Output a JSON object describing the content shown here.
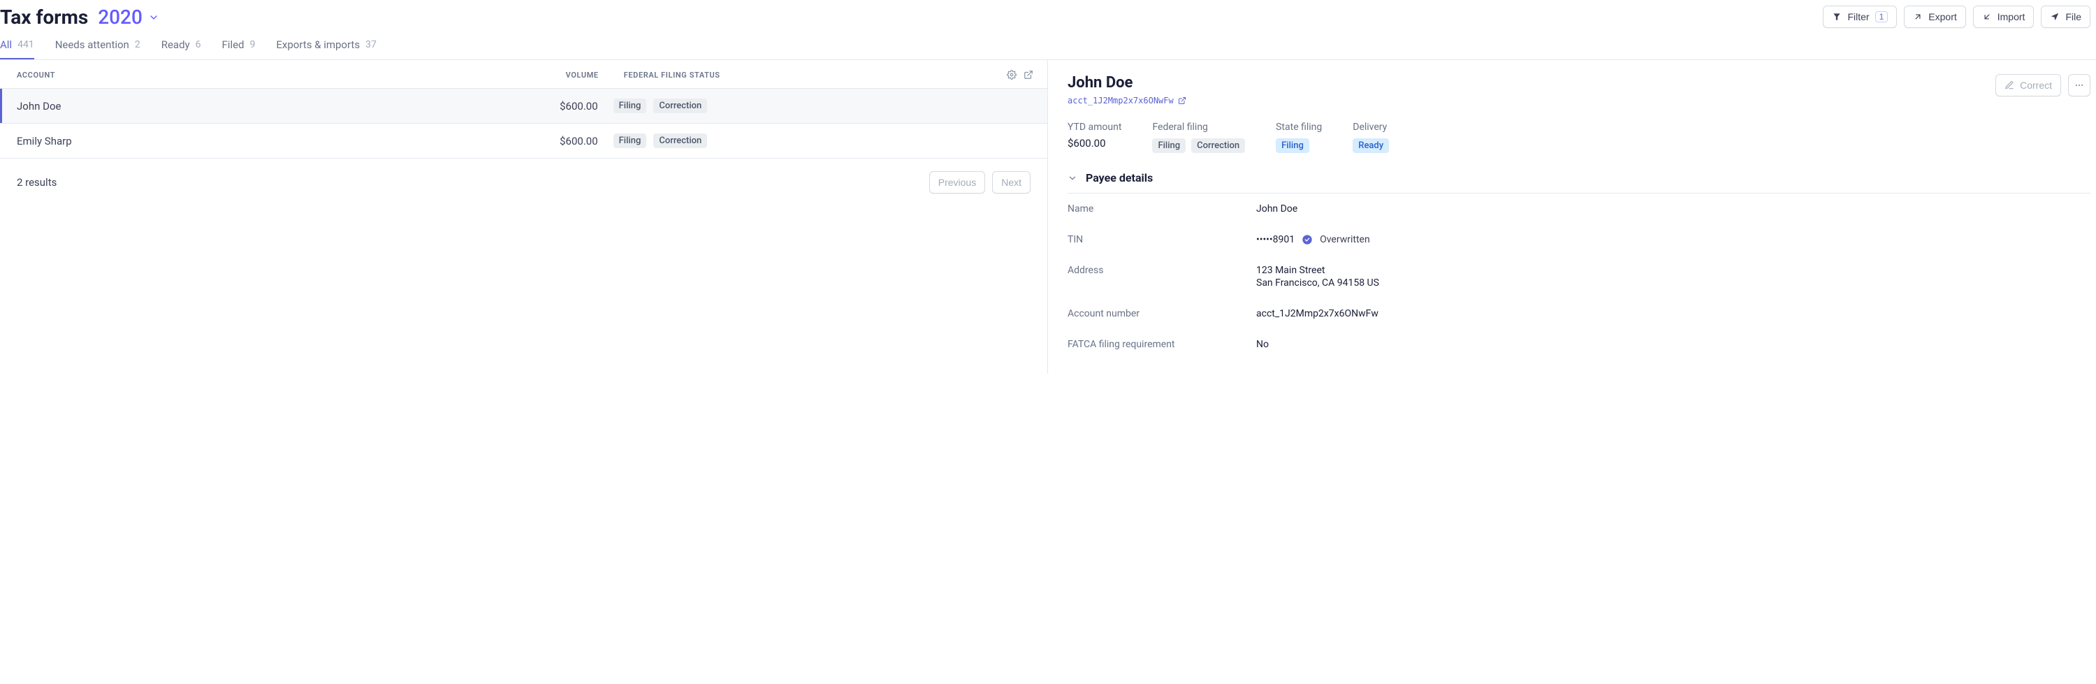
{
  "header": {
    "title": "Tax forms",
    "year": "2020",
    "toolbar": {
      "filter_label": "Filter",
      "filter_count": "1",
      "export_label": "Export",
      "import_label": "Import",
      "file_label": "File"
    }
  },
  "tabs": {
    "all": {
      "label": "All",
      "count": "441"
    },
    "needs": {
      "label": "Needs attention",
      "count": "2"
    },
    "ready": {
      "label": "Ready",
      "count": "6"
    },
    "filed": {
      "label": "Filed",
      "count": "9"
    },
    "exports": {
      "label": "Exports & imports",
      "count": "37"
    }
  },
  "table": {
    "columns": {
      "account": "Account",
      "volume": "Volume",
      "status": "Federal Filing Status"
    },
    "rows": [
      {
        "account": "John Doe",
        "volume": "$600.00",
        "badge1": "Filing",
        "badge2": "Correction"
      },
      {
        "account": "Emily Sharp",
        "volume": "$600.00",
        "badge1": "Filing",
        "badge2": "Correction"
      }
    ],
    "results_text": "2 results",
    "pager": {
      "prev": "Previous",
      "next": "Next"
    }
  },
  "detail": {
    "name": "John Doe",
    "account_id": "acct_1J2Mmp2x7x6ONwFw",
    "actions": {
      "correct": "Correct"
    },
    "summary": {
      "ytd_label": "YTD amount",
      "ytd_value": "$600.00",
      "federal_label": "Federal filing",
      "federal_badge1": "Filing",
      "federal_badge2": "Correction",
      "state_label": "State filing",
      "state_badge": "Filing",
      "delivery_label": "Delivery",
      "delivery_badge": "Ready"
    },
    "payee": {
      "section_title": "Payee details",
      "name_label": "Name",
      "name_value": "John Doe",
      "tin_label": "TIN",
      "tin_value": "•••••8901",
      "tin_note": "Overwritten",
      "address_label": "Address",
      "address_line1": "123 Main Street",
      "address_line2": "San Francisco, CA 94158 US",
      "acct_label": "Account number",
      "acct_value": "acct_1J2Mmp2x7x6ONwFw",
      "fatca_label": "FATCA filing requirement",
      "fatca_value": "No"
    }
  }
}
